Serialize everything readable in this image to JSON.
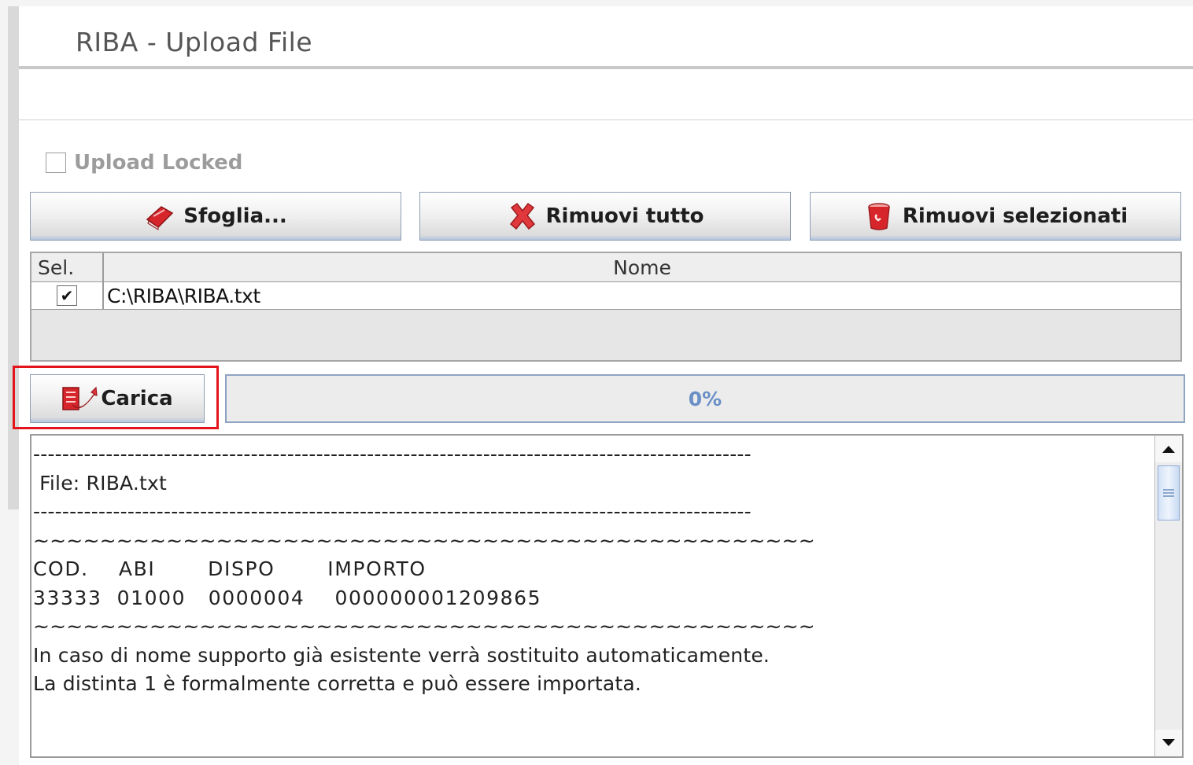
{
  "window": {
    "title": "RIBA - Upload File"
  },
  "options": {
    "upload_locked_label": "Upload Locked",
    "upload_locked_checked": false
  },
  "toolbar": {
    "browse_label": "Sfoglia...",
    "remove_all_label": "Rimuovi tutto",
    "remove_selected_label": "Rimuovi selezionati"
  },
  "file_table": {
    "columns": [
      "Sel.",
      "Nome"
    ],
    "rows": [
      {
        "selected": true,
        "name": "C:\\RIBA\\RIBA.txt"
      }
    ]
  },
  "upload": {
    "load_label": "Carica",
    "progress_text": "0%",
    "progress_value": 0
  },
  "log": {
    "lines": [
      "---------------------------------------------------------------------------------------------------",
      " File: RIBA.txt",
      "---------------------------------------------------------------------------------------------------",
      "~~~~~~~~~~~~~~~~~~~~~~~~~~~~~~~~~~~~~~~~~~~~~~~",
      "COD.    ABI       DISPO       IMPORTO",
      "33333  01000   0000004    000000001209865",
      "~~~~~~~~~~~~~~~~~~~~~~~~~~~~~~~~~~~~~~~~~~~~~~~",
      "In caso di nome supporto già esistente verrà sostituito automaticamente.",
      "La distinta 1 è formalmente corretta e può essere importata."
    ]
  },
  "colors": {
    "highlight": "#e3141b",
    "progress_text": "#6a8fc6",
    "icon_red": "#d7262b"
  },
  "icons": {
    "browse": "book-icon",
    "remove_all": "red-x-icon",
    "remove_selected": "trash-can-icon",
    "load": "upload-arrow-icon"
  }
}
